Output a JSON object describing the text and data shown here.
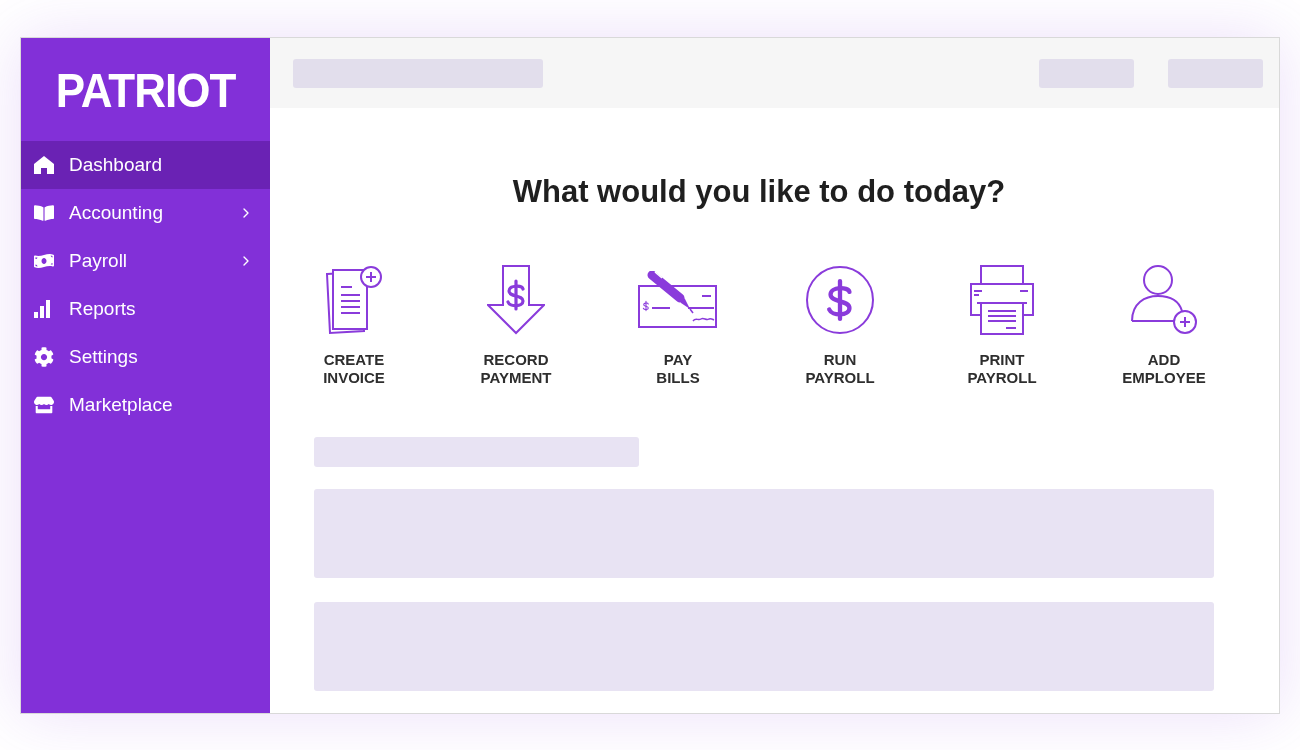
{
  "sidebar": {
    "logo": "PATRIOT",
    "items": [
      {
        "label": "Dashboard",
        "selected": true,
        "expandable": false
      },
      {
        "label": "Accounting",
        "selected": false,
        "expandable": true
      },
      {
        "label": "Payroll",
        "selected": false,
        "expandable": true
      },
      {
        "label": "Reports",
        "selected": false,
        "expandable": false
      },
      {
        "label": "Settings",
        "selected": false,
        "expandable": false
      },
      {
        "label": "Marketplace",
        "selected": false,
        "expandable": false
      }
    ]
  },
  "main": {
    "heading": "What would you like to do today?",
    "actions": [
      {
        "label": "CREATE INVOICE"
      },
      {
        "label": "RECORD PAYMENT"
      },
      {
        "label": "PAY BILLS"
      },
      {
        "label": "RUN PAYROLL"
      },
      {
        "label": "PRINT PAYROLL"
      },
      {
        "label": "ADD EMPLOYEE"
      }
    ]
  }
}
